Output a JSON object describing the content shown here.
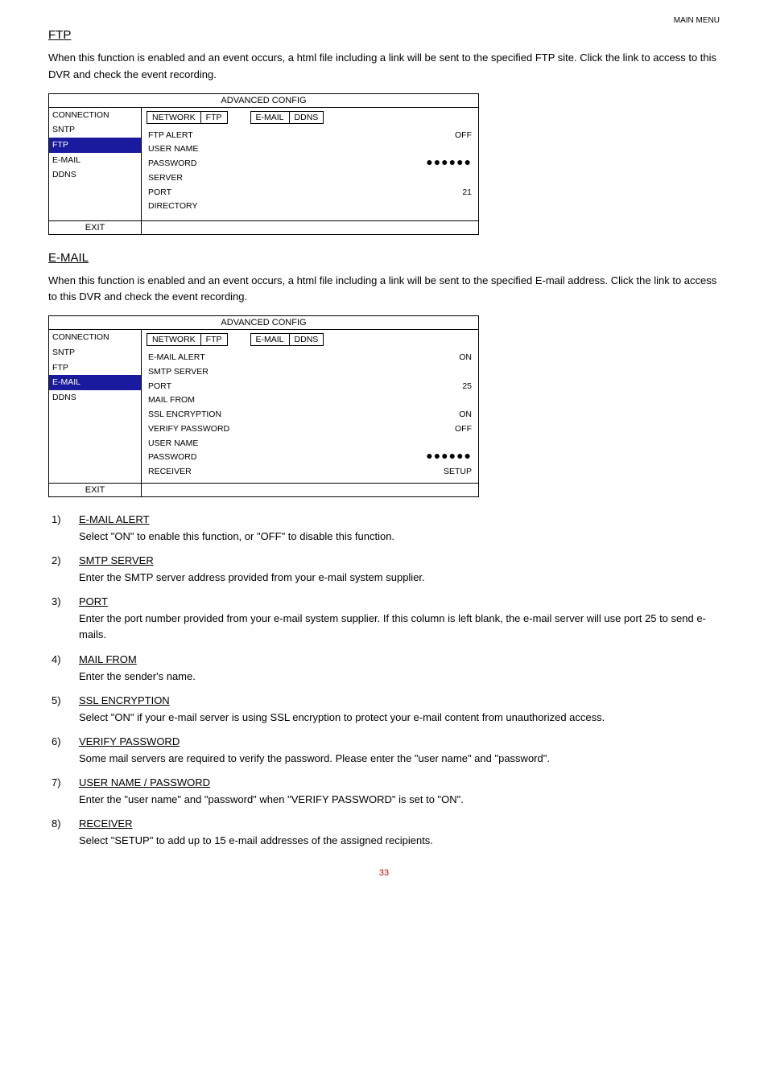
{
  "header": {
    "right": "MAIN MENU"
  },
  "ftp": {
    "title": "FTP",
    "intro": "When this function is enabled and an event occurs, a html file including a link will be sent to the specified FTP site. Click the link to access to this DVR and check the event recording.",
    "panel": {
      "title": "ADVANCED CONFIG",
      "sidebar": [
        "CONNECTION",
        "SNTP",
        "FTP",
        "E-MAIL",
        "DDNS"
      ],
      "selectedIndex": 2,
      "tabs": [
        "NETWORK",
        "FTP",
        "E-MAIL",
        "DDNS"
      ],
      "rows": [
        {
          "k": "FTP ALERT",
          "v": "OFF"
        },
        {
          "k": "USER NAME",
          "v": ""
        },
        {
          "k": "PASSWORD",
          "v": "●●●●●●",
          "dots": true
        },
        {
          "k": "SERVER",
          "v": ""
        },
        {
          "k": "PORT",
          "v": "21"
        },
        {
          "k": "DIRECTORY",
          "v": ""
        }
      ],
      "footer": "EXIT"
    }
  },
  "email": {
    "title": "E-MAIL",
    "intro": "When this function is enabled and an event occurs, a html file including a link will be sent to the specified E-mail address. Click the link to access to this DVR and check the event recording.",
    "panel": {
      "title": "ADVANCED CONFIG",
      "sidebar": [
        "CONNECTION",
        "SNTP",
        "FTP",
        "E-MAIL",
        "DDNS"
      ],
      "selectedIndex": 3,
      "tabs": [
        "NETWORK",
        "FTP",
        "E-MAIL",
        "DDNS"
      ],
      "rows": [
        {
          "k": "E-MAIL ALERT",
          "v": "ON"
        },
        {
          "k": "SMTP SERVER",
          "v": ""
        },
        {
          "k": "PORT",
          "v": "25"
        },
        {
          "k": "MAIL FROM",
          "v": ""
        },
        {
          "k": "SSL ENCRYPTION",
          "v": "ON"
        },
        {
          "k": "VERIFY PASSWORD",
          "v": "OFF"
        },
        {
          "k": "USER NAME",
          "v": ""
        },
        {
          "k": "PASSWORD",
          "v": "●●●●●●",
          "dots": true
        },
        {
          "k": "RECEIVER",
          "v": "SETUP"
        }
      ],
      "footer": "EXIT"
    }
  },
  "defs": [
    {
      "term": "E-MAIL ALERT",
      "desc": "Select \"ON\" to enable this function, or \"OFF\" to disable this function."
    },
    {
      "term": "SMTP SERVER",
      "desc": "Enter the SMTP server address provided from your e-mail system supplier."
    },
    {
      "term": "PORT",
      "desc": "Enter the port number provided from your e-mail system supplier. If this column is left blank, the e-mail server will use port 25 to send e-mails."
    },
    {
      "term": "MAIL FROM",
      "desc": "Enter the sender's name."
    },
    {
      "term": "SSL ENCRYPTION",
      "desc": "Select \"ON\" if your e-mail server is using SSL encryption to protect your e-mail content from unauthorized access."
    },
    {
      "term": "VERIFY PASSWORD",
      "desc": "Some mail servers are required to verify the password. Please enter the \"user name\" and \"password\"."
    },
    {
      "term": "USER NAME / PASSWORD",
      "desc": "Enter the \"user name\" and \"password\" when \"VERIFY PASSWORD\" is set to \"ON\"."
    },
    {
      "term": "RECEIVER",
      "desc": "Select \"SETUP\" to add up to 15 e-mail addresses of the assigned recipients."
    }
  ],
  "pageNumber": "33"
}
